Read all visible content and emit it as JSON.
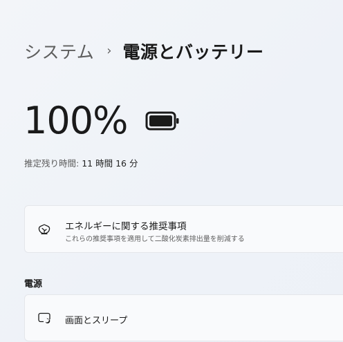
{
  "breadcrumb": {
    "parent": "システム",
    "separator": "›",
    "current": "電源とバッテリー"
  },
  "battery": {
    "percent_label": "100%",
    "level": 1.0,
    "remaining_label": "推定残り時間:",
    "remaining_value": "11 時間 16 分"
  },
  "recommendations": {
    "icon": "leaf-icon",
    "title": "エネルギーに関する推奨事項",
    "subtitle": "これらの推奨事項を適用して二酸化炭素排出量を削減する"
  },
  "power_section": {
    "heading": "電源",
    "screen_sleep": {
      "icon": "screen-sleep-icon",
      "title": "画面とスリープ"
    }
  }
}
